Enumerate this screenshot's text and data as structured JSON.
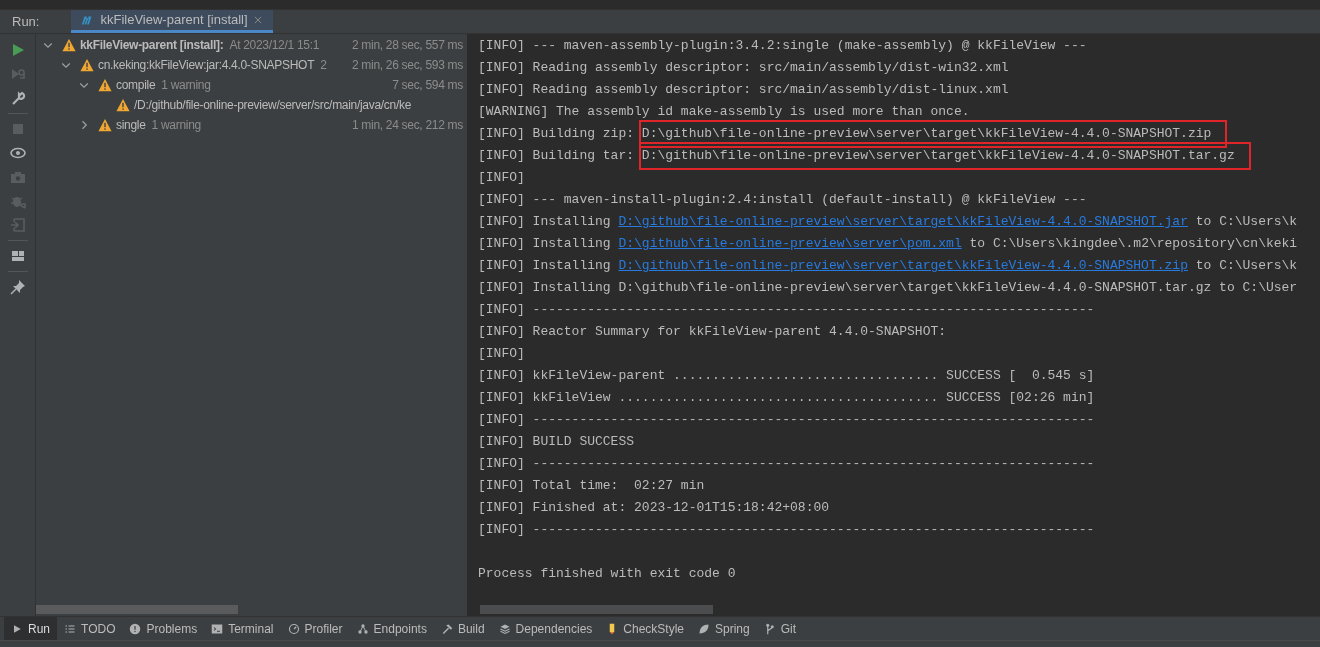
{
  "run_tabs": {
    "label": "Run:",
    "tabs": [
      {
        "label": "kkFileView-parent [install]",
        "selected": true
      }
    ]
  },
  "toolbar": [
    {
      "kind": "run",
      "disabled": false
    },
    {
      "kind": "rerun",
      "disabled": true
    },
    {
      "kind": "wrench",
      "disabled": false
    },
    {
      "kind": "stop",
      "disabled": true
    },
    {
      "kind": "eye",
      "disabled": false
    },
    {
      "kind": "camera",
      "disabled": true
    },
    {
      "kind": "bug",
      "disabled": true
    },
    {
      "kind": "import",
      "disabled": true
    },
    {
      "kind": "layout",
      "disabled": false
    },
    {
      "kind": "pin",
      "disabled": false
    }
  ],
  "tree": [
    {
      "label": "kkFileView-parent [install]:",
      "detail": "At 2023/12/1 15:1",
      "time": "2 min, 28 sec, 557 ms",
      "bold": true,
      "expanded": true,
      "children": [
        {
          "label": "cn.keking:kkFileView:jar:4.4.0-SNAPSHOT",
          "detail": "2",
          "time": "2 min, 26 sec, 593 ms",
          "bold": false,
          "expanded": true,
          "children": [
            {
              "label": "compile",
              "detail": "1 warning",
              "time": "7 sec, 594 ms",
              "bold": false,
              "expanded": true,
              "children": [
                {
                  "label": "/D:/github/file-online-preview/server/src/main/java/cn/ke",
                  "bold": false
                }
              ]
            },
            {
              "label": "single",
              "detail": "1 warning",
              "time": "1 min, 24 sec, 212 ms",
              "bold": false,
              "expanded": false
            }
          ]
        }
      ]
    }
  ],
  "console": [
    [
      {
        "text": "[INFO] --- maven-assembly-plugin:3.4.2:single (make-assembly) @ kkFileView ---"
      }
    ],
    [
      {
        "text": "[INFO] Reading assembly descriptor: src/main/assembly/dist-win32.xml"
      }
    ],
    [
      {
        "text": "[INFO] Reading assembly descriptor: src/main/assembly/dist-linux.xml"
      }
    ],
    [
      {
        "text": "[WARNING] The assembly id make-assembly is used more than once."
      }
    ],
    [
      {
        "text": "[INFO] Building zip: "
      },
      {
        "text": "D:\\github\\file-online-preview\\server\\target\\kkFileView-4.4.0-SNAPSHOT.zip",
        "boxed": true
      }
    ],
    [
      {
        "text": "[INFO] Building tar: "
      },
      {
        "text": "D:\\github\\file-online-preview\\server\\target\\kkFileView-4.4.0-SNAPSHOT.tar.gz",
        "boxed": true
      }
    ],
    [
      {
        "text": "[INFO]"
      }
    ],
    [
      {
        "text": "[INFO] --- maven-install-plugin:2.4:install (default-install) @ kkFileView ---"
      }
    ],
    [
      {
        "text": "[INFO] Installing "
      },
      {
        "text": "D:\\github\\file-online-preview\\server\\target\\kkFileView-4.4.0-SNAPSHOT.jar",
        "link": true
      },
      {
        "text": " to C:\\Users\\k"
      }
    ],
    [
      {
        "text": "[INFO] Installing "
      },
      {
        "text": "D:\\github\\file-online-preview\\server\\pom.xml",
        "link": true
      },
      {
        "text": " to C:\\Users\\kingdee\\.m2\\repository\\cn\\keki"
      }
    ],
    [
      {
        "text": "[INFO] Installing "
      },
      {
        "text": "D:\\github\\file-online-preview\\server\\target\\kkFileView-4.4.0-SNAPSHOT.zip",
        "link": true
      },
      {
        "text": " to C:\\Users\\k"
      }
    ],
    [
      {
        "text": "[INFO] Installing D:\\github\\file-online-preview\\server\\target\\kkFileView-4.4.0-SNAPSHOT.tar.gz to C:\\User"
      }
    ],
    [
      {
        "text": "[INFO] ------------------------------------------------------------------------"
      }
    ],
    [
      {
        "text": "[INFO] Reactor Summary for kkFileView-parent 4.4.0-SNAPSHOT:"
      }
    ],
    [
      {
        "text": "[INFO]"
      }
    ],
    [
      {
        "text": "[INFO] kkFileView-parent .................................. SUCCESS [  0.545 s]"
      }
    ],
    [
      {
        "text": "[INFO] kkFileView ......................................... SUCCESS [02:26 min]"
      }
    ],
    [
      {
        "text": "[INFO] ------------------------------------------------------------------------"
      }
    ],
    [
      {
        "text": "[INFO] BUILD SUCCESS"
      }
    ],
    [
      {
        "text": "[INFO] ------------------------------------------------------------------------"
      }
    ],
    [
      {
        "text": "[INFO] Total time:  02:27 min"
      }
    ],
    [
      {
        "text": "[INFO] Finished at: 2023-12-01T15:18:42+08:00"
      }
    ],
    [
      {
        "text": "[INFO] ------------------------------------------------------------------------"
      }
    ]
  ],
  "exit_message": "Process finished with exit code 0",
  "bottom_tabs": [
    {
      "label": "Run",
      "selected": true
    },
    {
      "label": "TODO",
      "selected": false
    },
    {
      "label": "Problems",
      "selected": false
    },
    {
      "label": "Terminal",
      "selected": false
    },
    {
      "label": "Profiler",
      "selected": false
    },
    {
      "label": "Endpoints",
      "selected": false
    },
    {
      "label": "Build",
      "selected": false
    },
    {
      "label": "Dependencies",
      "selected": false
    },
    {
      "label": "CheckStyle",
      "selected": false
    },
    {
      "label": "Spring",
      "selected": false
    },
    {
      "label": "Git",
      "selected": false
    }
  ]
}
